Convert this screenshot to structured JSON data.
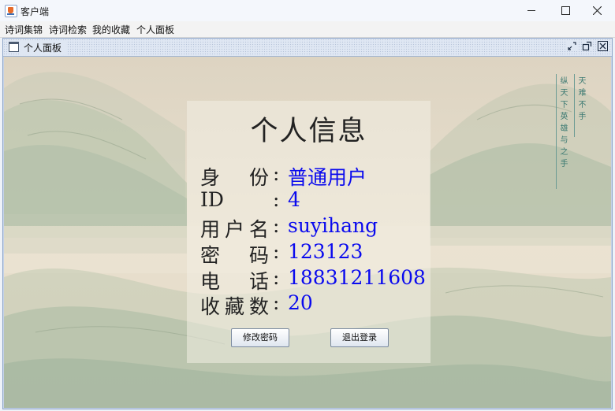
{
  "window": {
    "title": "客户端"
  },
  "menu": [
    "诗词集锦",
    "诗词检索",
    "我的收藏",
    "个人面板"
  ],
  "internal_frame": {
    "title": "个人面板"
  },
  "poem": {
    "col1": "天难不手",
    "col2": "纵天下英雄与之手"
  },
  "profile": {
    "heading": "个人信息",
    "fields": [
      {
        "label": "身份",
        "value": "普通用户"
      },
      {
        "label": "ID",
        "value": "4"
      },
      {
        "label": "用户名",
        "value": "suyihang"
      },
      {
        "label": "密码",
        "value": "123123"
      },
      {
        "label": "电话",
        "value": "18831211608"
      },
      {
        "label": "收藏数",
        "value": "20"
      }
    ],
    "colon": ":"
  },
  "buttons": {
    "change_password": "修改密码",
    "logout": "退出登录"
  },
  "colors": {
    "value_text": "#0a0aee",
    "label_text": "#222222",
    "poem_text": "#3c7a72"
  }
}
